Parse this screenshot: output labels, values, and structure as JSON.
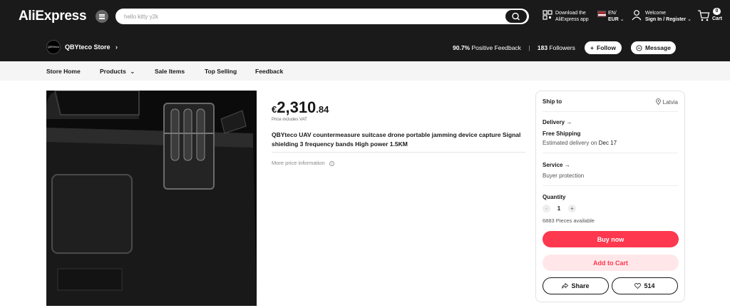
{
  "header": {
    "logo": "AliExpress",
    "search_value": "hello kitty y2k",
    "download_line1": "Download the",
    "download_line2": "AliExpress app",
    "lang_line1": "EN/",
    "lang_line2": "EUR",
    "welcome_line1": "Welcome",
    "welcome_line2": "Sign In / Register",
    "cart_count": "0",
    "cart_label": "Cart"
  },
  "store": {
    "logo_text": "QBYteco",
    "name": "QBYteco Store",
    "feedback_value": "90.7%",
    "feedback_label": "Positive Feedback",
    "followers_value": "183",
    "followers_label": "Followers",
    "follow_label": "Follow",
    "message_label": "Message"
  },
  "nav": {
    "items": [
      "Store Home",
      "Products",
      "Sale Items",
      "Top Selling",
      "Feedback"
    ]
  },
  "product": {
    "currency": "€",
    "price_main": "2,310",
    "price_cents": ".84",
    "vat_note": "Price includes VAT",
    "title": "QBYteco UAV countermeasure suitcase drone portable jamming device capture Signal shielding 3 frequency bands High power 1.5KM",
    "more_price": "More price information"
  },
  "panel": {
    "ship_to_label": "Ship to",
    "ship_to_value": "Latvia",
    "delivery_label": "Delivery",
    "free_shipping": "Free Shipping",
    "estimated_prefix": "Estimated delivery on",
    "estimated_date": "Dec 17",
    "service_label": "Service",
    "service_value": "Buyer protection",
    "quantity_label": "Quantity",
    "quantity_value": "1",
    "available": "6883 Pieces available",
    "buy_now": "Buy now",
    "add_to_cart": "Add to Cart",
    "share": "Share",
    "wishlist_count": "514"
  },
  "colors": {
    "brand_red": "#fd384f",
    "cart_pink": "#ffe7e9",
    "header_bg": "#1a1a1a"
  }
}
